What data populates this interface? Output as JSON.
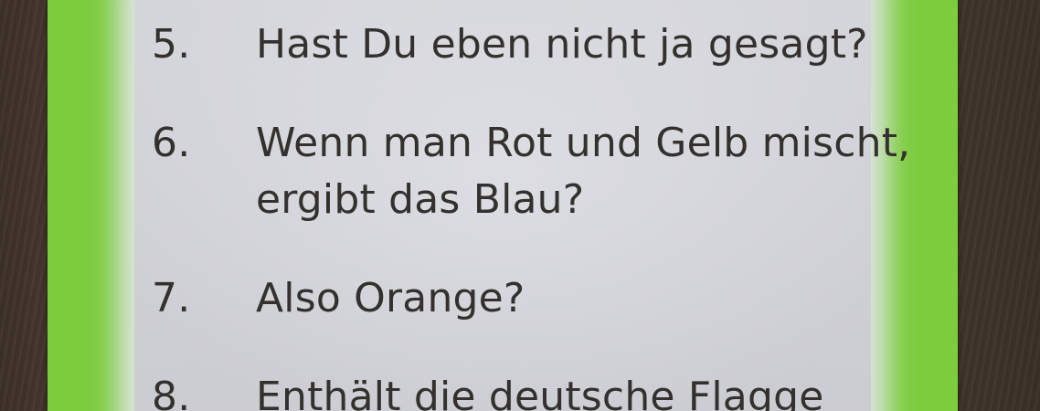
{
  "card": {
    "questions": [
      {
        "number": "5.",
        "line1": "Hast Du eben nicht ja gesagt?",
        "line2": ""
      },
      {
        "number": "6.",
        "line1": "Wenn man Rot und Gelb mischt,",
        "line2": "ergibt das Blau?"
      },
      {
        "number": "7.",
        "line1": "Also Orange?",
        "line2": ""
      },
      {
        "number": "8.",
        "line1": "Enthält die deutsche Flagge",
        "line2": ""
      }
    ]
  },
  "colors": {
    "card_border": "#7ccc3e",
    "card_face": "#dedfe4",
    "text": "#33302d",
    "table_wood": "#4a3b31"
  }
}
